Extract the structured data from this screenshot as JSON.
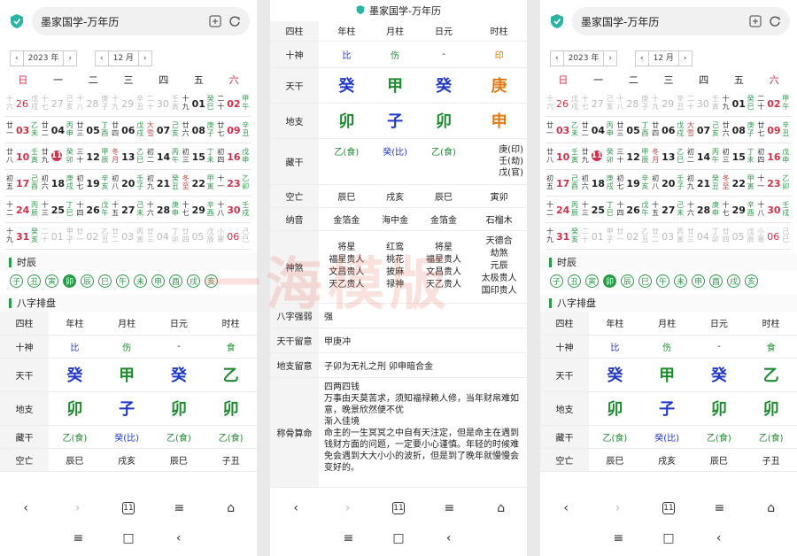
{
  "browser": {
    "title": "墨家国学-万年历"
  },
  "selector": {
    "year": "2023 年",
    "month": "12 月"
  },
  "weekdays": [
    "日",
    "一",
    "二",
    "三",
    "四",
    "五",
    "六"
  ],
  "calendar": [
    [
      {
        "p": "十六",
        "d": "26",
        "g": "戊戌",
        "dim": true
      },
      {
        "p": "十七",
        "d": "27",
        "g": "己亥",
        "dim": true
      },
      {
        "p": "十八",
        "d": "28",
        "g": "庚子",
        "dim": true
      },
      {
        "p": "十九",
        "d": "29",
        "g": "辛丑",
        "dim": true
      },
      {
        "p": "二十",
        "d": "30",
        "g": "壬寅",
        "dim": true
      },
      {
        "p": "十九",
        "d": "01",
        "g": "癸巳"
      },
      {
        "p": "二十",
        "d": "02",
        "g": "甲午"
      }
    ],
    [
      {
        "p": "廿一",
        "d": "03",
        "g": "乙未"
      },
      {
        "p": "廿二",
        "d": "04",
        "g": "丙申"
      },
      {
        "p": "廿三",
        "d": "05",
        "g": "丁酉"
      },
      {
        "p": "廿四",
        "d": "06",
        "g": "戊戌"
      },
      {
        "p": "大雪",
        "d": "07",
        "g": "己亥",
        "term": true
      },
      {
        "p": "廿六",
        "d": "08",
        "g": "庚子"
      },
      {
        "p": "廿七",
        "d": "09",
        "g": "辛丑"
      }
    ],
    [
      {
        "p": "廿八",
        "d": "10",
        "g": "壬寅"
      },
      {
        "p": "廿九",
        "d": "11",
        "g": "癸卯",
        "sel": true
      },
      {
        "p": "三十",
        "d": "12",
        "g": "甲辰"
      },
      {
        "p": "冬月",
        "d": "13",
        "g": "乙巳",
        "term": true
      },
      {
        "p": "初二",
        "d": "14",
        "g": "丙午"
      },
      {
        "p": "初三",
        "d": "15",
        "g": "丁未"
      },
      {
        "p": "初四",
        "d": "16",
        "g": "戊申"
      }
    ],
    [
      {
        "p": "初五",
        "d": "17",
        "g": "己酉"
      },
      {
        "p": "初六",
        "d": "18",
        "g": "庚戌"
      },
      {
        "p": "初七",
        "d": "19",
        "g": "辛亥"
      },
      {
        "p": "初八",
        "d": "20",
        "g": "壬子"
      },
      {
        "p": "初九",
        "d": "21",
        "g": "癸丑"
      },
      {
        "p": "冬至",
        "d": "22",
        "g": "甲寅",
        "term": true
      },
      {
        "p": "十一",
        "d": "23",
        "g": "乙卯"
      }
    ],
    [
      {
        "p": "十二",
        "d": "24",
        "g": "丙辰"
      },
      {
        "p": "十三",
        "d": "25",
        "g": "丁巳"
      },
      {
        "p": "十四",
        "d": "26",
        "g": "戊午"
      },
      {
        "p": "十五",
        "d": "27",
        "g": "己未"
      },
      {
        "p": "十六",
        "d": "28",
        "g": "庚申"
      },
      {
        "p": "十七",
        "d": "29",
        "g": "辛酉"
      },
      {
        "p": "十八",
        "d": "30",
        "g": "壬戌"
      }
    ],
    [
      {
        "p": "十九",
        "d": "31",
        "g": "癸亥"
      },
      {
        "p": "二十",
        "d": "01",
        "g": "甲子",
        "dim": true
      },
      {
        "p": "廿一",
        "d": "02",
        "g": "乙丑",
        "dim": true
      },
      {
        "p": "廿二",
        "d": "03",
        "g": "丙寅",
        "dim": true
      },
      {
        "p": "廿三",
        "d": "04",
        "g": "丁卯",
        "dim": true
      },
      {
        "p": "廿四",
        "d": "05",
        "g": "戊辰",
        "dim": true
      },
      {
        "p": "小寒",
        "d": "06",
        "g": "己巳",
        "dim": true
      }
    ]
  ],
  "sections": {
    "hours": "时辰",
    "bazi": "八字排盘"
  },
  "hours": [
    "子",
    "丑",
    "寅",
    "卯",
    "辰",
    "巳",
    "午",
    "未",
    "申",
    "酉",
    "戌",
    "亥"
  ],
  "bazi": {
    "headers": [
      "四柱",
      "年柱",
      "月柱",
      "日元",
      "时柱"
    ],
    "shishen": {
      "label": "十神",
      "v": [
        "比",
        "伤",
        "-",
        "印"
      ]
    },
    "shishen3": {
      "v": [
        "比",
        "伤",
        "-",
        "食"
      ]
    },
    "tiangan": {
      "label": "天干",
      "v": [
        "癸",
        "甲",
        "癸",
        "庚"
      ]
    },
    "tiangan3": {
      "v": [
        "癸",
        "甲",
        "癸",
        "乙"
      ]
    },
    "dizhi": {
      "label": "地支",
      "v": [
        "卯",
        "子",
        "卯",
        "申"
      ]
    },
    "dizhi3": {
      "v": [
        "卯",
        "子",
        "卯",
        "卯"
      ]
    },
    "zanggan": {
      "label": "藏干",
      "v": [
        "乙(食)",
        "癸(比)",
        "乙(食)",
        "庚(印)\n壬(劫)\n戊(官)"
      ]
    },
    "zanggan3": {
      "v": [
        "乙(食)",
        "癸(比)",
        "乙(食)",
        "乙(食)"
      ]
    },
    "kongwang": {
      "label": "空亡",
      "v": [
        "辰巳",
        "戌亥",
        "辰巳",
        "寅卯"
      ]
    },
    "kongwang1": {
      "v": [
        "辰巳",
        "戌亥",
        "辰巳",
        "子丑"
      ]
    },
    "nayin": {
      "label": "纳音",
      "v": [
        "金箔金",
        "海中金",
        "金箔金",
        "石榴木"
      ]
    },
    "shensha": {
      "label": "神煞",
      "v": [
        "将星\n福星贵人\n文昌贵人\n天乙贵人",
        "红鸾\n桃花\n披麻\n禄神",
        "将星\n福星贵人\n文昌贵人\n天乙贵人",
        "天德合\n劫煞\n元辰\n太极贵人\n国印贵人"
      ]
    },
    "qiangruo": {
      "label": "八字强弱",
      "v": "强"
    },
    "tgly": {
      "label": "天干留意",
      "v": "甲庚冲"
    },
    "dzly": {
      "label": "地支留意",
      "v": "子卯为无礼之刑 卯申暗合金"
    },
    "chenggu": {
      "label": "称骨算命",
      "v": "四两四钱\n万事由天莫苦求，须知福禄赖人修，当年财帛难如意，晚景欣然便不优\n渐入佳境\n命主的一生冥冥之中自有天注定，但是命主在遇到钱财方面的问题，一定要小心谨慎。年轻的时候难免会遇到大大小小的波折，但是到了晚年就慢慢会变好的。"
    }
  },
  "p2header": "八字排盘",
  "watermark": "一海模版",
  "colors": {
    "accent": "#2a9b49",
    "red": "#d0314a",
    "blue": "#2038c8",
    "green": "#1e8a2e",
    "orange": "#e07a14"
  }
}
